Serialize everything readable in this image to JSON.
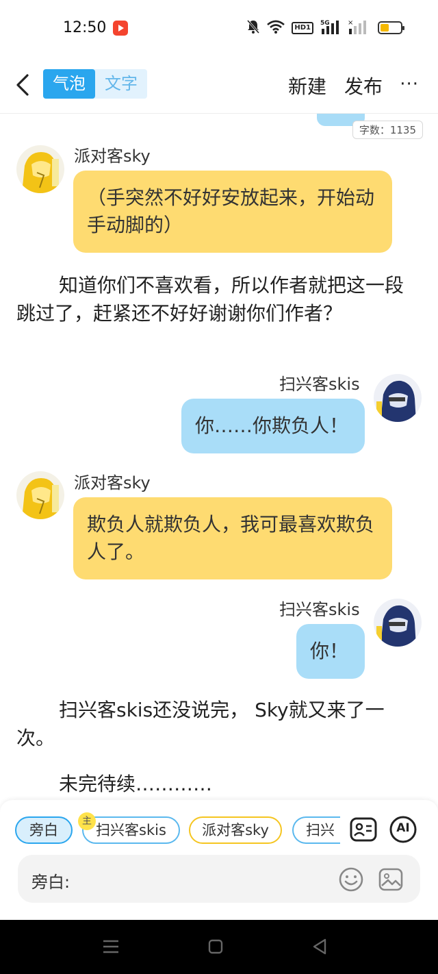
{
  "status_bar": {
    "time": "12:50",
    "network": "5G",
    "hd_label": "HD1"
  },
  "header": {
    "tabs": [
      {
        "label": "气泡",
        "active": true
      },
      {
        "label": "文字",
        "active": false
      }
    ],
    "new_label": "新建",
    "publish_label": "发布",
    "more_label": "···"
  },
  "word_count": "字数：1135",
  "messages": [
    {
      "type": "bubble",
      "side": "left",
      "name": "派对客sky",
      "text": "（手突然不好好安放起来，开始动手动脚的）"
    },
    {
      "type": "narration",
      "text": "知道你们不喜欢看，所以作者就把这一段跳过了，赶紧还不好好谢谢你们作者？"
    },
    {
      "type": "bubble",
      "side": "right",
      "name": "扫兴客skis",
      "text": "你……你欺负人！"
    },
    {
      "type": "bubble",
      "side": "left",
      "name": "派对客sky",
      "text": "欺负人就欺负人，我可最喜欢欺负人了。"
    },
    {
      "type": "bubble",
      "side": "right",
      "name": "扫兴客skis",
      "text": "你！"
    },
    {
      "type": "narration",
      "text": "扫兴客skis还没说完， Sky就又来了一次。"
    },
    {
      "type": "narration",
      "text": "未完待续…………"
    }
  ],
  "composer": {
    "chips": [
      {
        "label": "旁白",
        "selected": true
      },
      {
        "label": "扫兴客skis",
        "owner_badge": "主"
      },
      {
        "label": "派对客sky"
      },
      {
        "label": "扫兴"
      }
    ],
    "input_label": "旁白:",
    "input_value": "",
    "ai_label": "AI"
  },
  "colors": {
    "accent": "#2aa6ee",
    "yellow_bubble": "#fedb71",
    "blue_bubble": "#a9ddf8"
  }
}
